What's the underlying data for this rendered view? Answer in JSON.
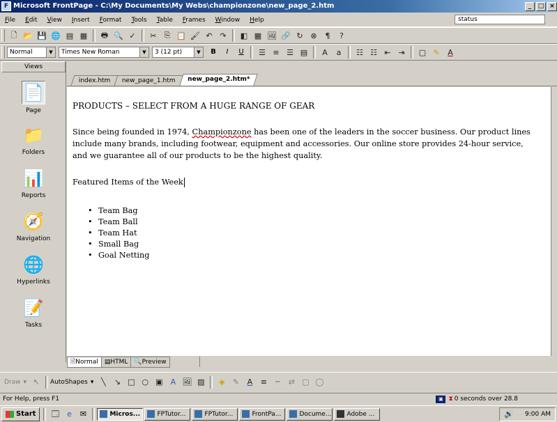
{
  "window": {
    "title": "Microsoft FrontPage - C:\\My Documents\\My Webs\\championzone\\new_page_2.htm",
    "buttons": [
      "_",
      "□",
      "×"
    ]
  },
  "menubar": {
    "items": [
      "File",
      "Edit",
      "View",
      "Insert",
      "Format",
      "Tools",
      "Table",
      "Frames",
      "Window",
      "Help"
    ],
    "status_box": "status"
  },
  "formatting": {
    "style": "Normal",
    "font": "Times New Roman",
    "size": "3 (12 pt)",
    "bold": "B",
    "italic": "I",
    "underline": "U"
  },
  "views": {
    "header": "Views",
    "items": [
      {
        "label": "Page",
        "icon": "page-icon"
      },
      {
        "label": "Folders",
        "icon": "folders-icon"
      },
      {
        "label": "Reports",
        "icon": "reports-icon"
      },
      {
        "label": "Navigation",
        "icon": "navigation-icon"
      },
      {
        "label": "Hyperlinks",
        "icon": "hyperlinks-icon"
      },
      {
        "label": "Tasks",
        "icon": "tasks-icon"
      }
    ]
  },
  "tabs": [
    {
      "label": "index.htm",
      "active": false
    },
    {
      "label": "new_page_1.htm",
      "active": false
    },
    {
      "label": "new_page_2.htm*",
      "active": true
    }
  ],
  "document": {
    "heading": "PRODUCTS – SELECT FROM A HUGE RANGE OF GEAR",
    "para_start": "Since being founded in 1974, ",
    "para_brand": "Championzone",
    "para_end": " has been one of the leaders in the soccer business. Our product lines include many brands, including footwear, equipment and accessories. Our online store provides 24-hour service, and we guarantee all of our products to be the highest quality.",
    "featured": "Featured Items of the Week",
    "items": [
      "Team Bag",
      "Team Ball",
      "Team Hat",
      "Small Bag",
      "Goal Netting"
    ]
  },
  "view_tabs": [
    {
      "label": "Normal",
      "active": true
    },
    {
      "label": "HTML",
      "active": false
    },
    {
      "label": "Preview",
      "active": false
    }
  ],
  "drawbar": {
    "draw_label": "Draw",
    "autoshapes_label": "AutoShapes"
  },
  "statusbar": {
    "help": "For Help, press F1",
    "download": "0 seconds over 28.8"
  },
  "taskbar": {
    "start": "Start",
    "tasks": [
      {
        "label": "Micros...",
        "active": true
      },
      {
        "label": "FPTutor...",
        "active": false
      },
      {
        "label": "FPTutor...",
        "active": false
      },
      {
        "label": "FrontPa...",
        "active": false
      },
      {
        "label": "Docume...",
        "active": false
      },
      {
        "label": "Adobe ...",
        "active": false
      }
    ],
    "clock": "9:00 AM"
  },
  "colors": {
    "titlebar": "#0a246a",
    "chrome": "#d4d0c8",
    "editor_bg": "#ffffff"
  }
}
